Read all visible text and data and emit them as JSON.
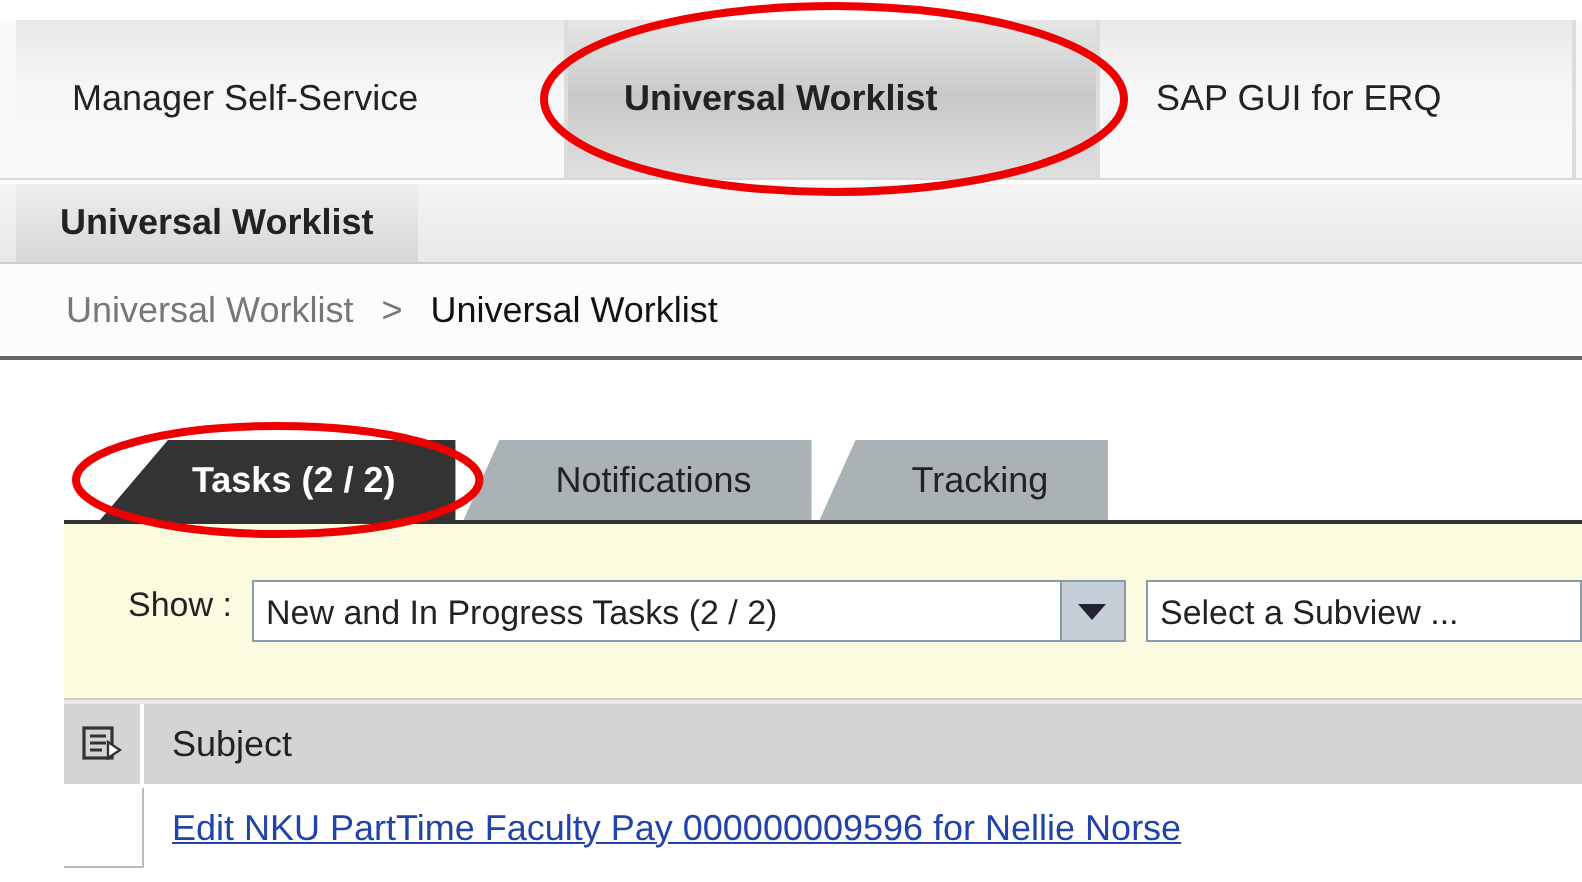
{
  "top_tabs": [
    {
      "label": "Manager Self-Service",
      "selected": false,
      "circled": false
    },
    {
      "label": "Universal Worklist",
      "selected": true,
      "circled": true
    },
    {
      "label": "SAP GUI for ERQ",
      "selected": false,
      "circled": false
    }
  ],
  "sub_nav": [
    {
      "label": "Universal Worklist",
      "selected": true
    }
  ],
  "breadcrumb": {
    "items": [
      "Universal Worklist",
      "Universal Worklist"
    ],
    "separator": ">"
  },
  "worklist_tabs": [
    {
      "label": "Tasks  (2 / 2)",
      "selected": true,
      "circled": true
    },
    {
      "label": "Notifications",
      "selected": false,
      "circled": false
    },
    {
      "label": "Tracking",
      "selected": false,
      "circled": false
    }
  ],
  "filter": {
    "label": "Show :",
    "view": "New  and In Progress Tasks  (2 / 2)",
    "subview": "Select a Subview ..."
  },
  "table": {
    "columns": [
      "Subject"
    ],
    "rows": [
      [
        "Edit  NKU PartTime Faculty Pay 000000009596 for Nellie Norse"
      ]
    ]
  }
}
